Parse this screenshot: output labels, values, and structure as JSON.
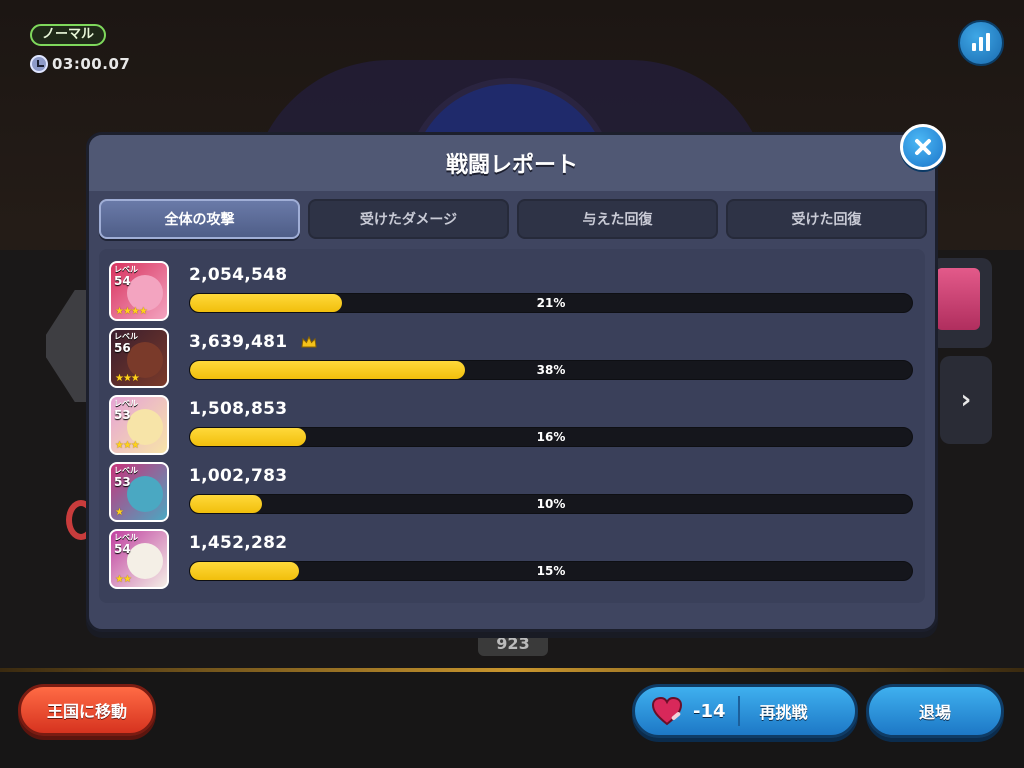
{
  "hud": {
    "mode": "ノーマル",
    "timer": "03:00.07",
    "stats_icon": "bar-chart-icon"
  },
  "background": {
    "side_arrow": "›",
    "score_chip": "923"
  },
  "dialog": {
    "title": "戦闘レポート",
    "close_icon": "close-icon",
    "tabs": [
      {
        "label": "全体の攻撃",
        "active": true
      },
      {
        "label": "受けたダメージ",
        "active": false
      },
      {
        "label": "与えた回復",
        "active": false
      },
      {
        "label": "受けた回復",
        "active": false
      }
    ],
    "level_prefix": "レベル",
    "rows": [
      {
        "level": "54",
        "stars": "★★★★",
        "value": "2,054,548",
        "percent_label": "21%",
        "percent": 21,
        "top": false,
        "colors": [
          "#d8325e",
          "#f3a4c0"
        ]
      },
      {
        "level": "56",
        "stars": "★★★",
        "value": "3,639,481",
        "percent_label": "38%",
        "percent": 38,
        "top": true,
        "colors": [
          "#3a1e2e",
          "#7a3a2a"
        ]
      },
      {
        "level": "53",
        "stars": "★★★",
        "value": "1,508,853",
        "percent_label": "16%",
        "percent": 16,
        "top": false,
        "colors": [
          "#e6a3d6",
          "#f7e4a8"
        ]
      },
      {
        "level": "53",
        "stars": "★",
        "value": "1,002,783",
        "percent_label": "10%",
        "percent": 10,
        "top": false,
        "colors": [
          "#c8327a",
          "#4aa8c2"
        ]
      },
      {
        "level": "54",
        "stars": "★★",
        "value": "1,452,282",
        "percent_label": "15%",
        "percent": 15,
        "top": false,
        "colors": [
          "#c040a0",
          "#f4efe6"
        ]
      }
    ]
  },
  "buttons": {
    "kingdom": "王国に移動",
    "retry_cost": "-14",
    "retry": "再挑戦",
    "exit": "退場"
  }
}
